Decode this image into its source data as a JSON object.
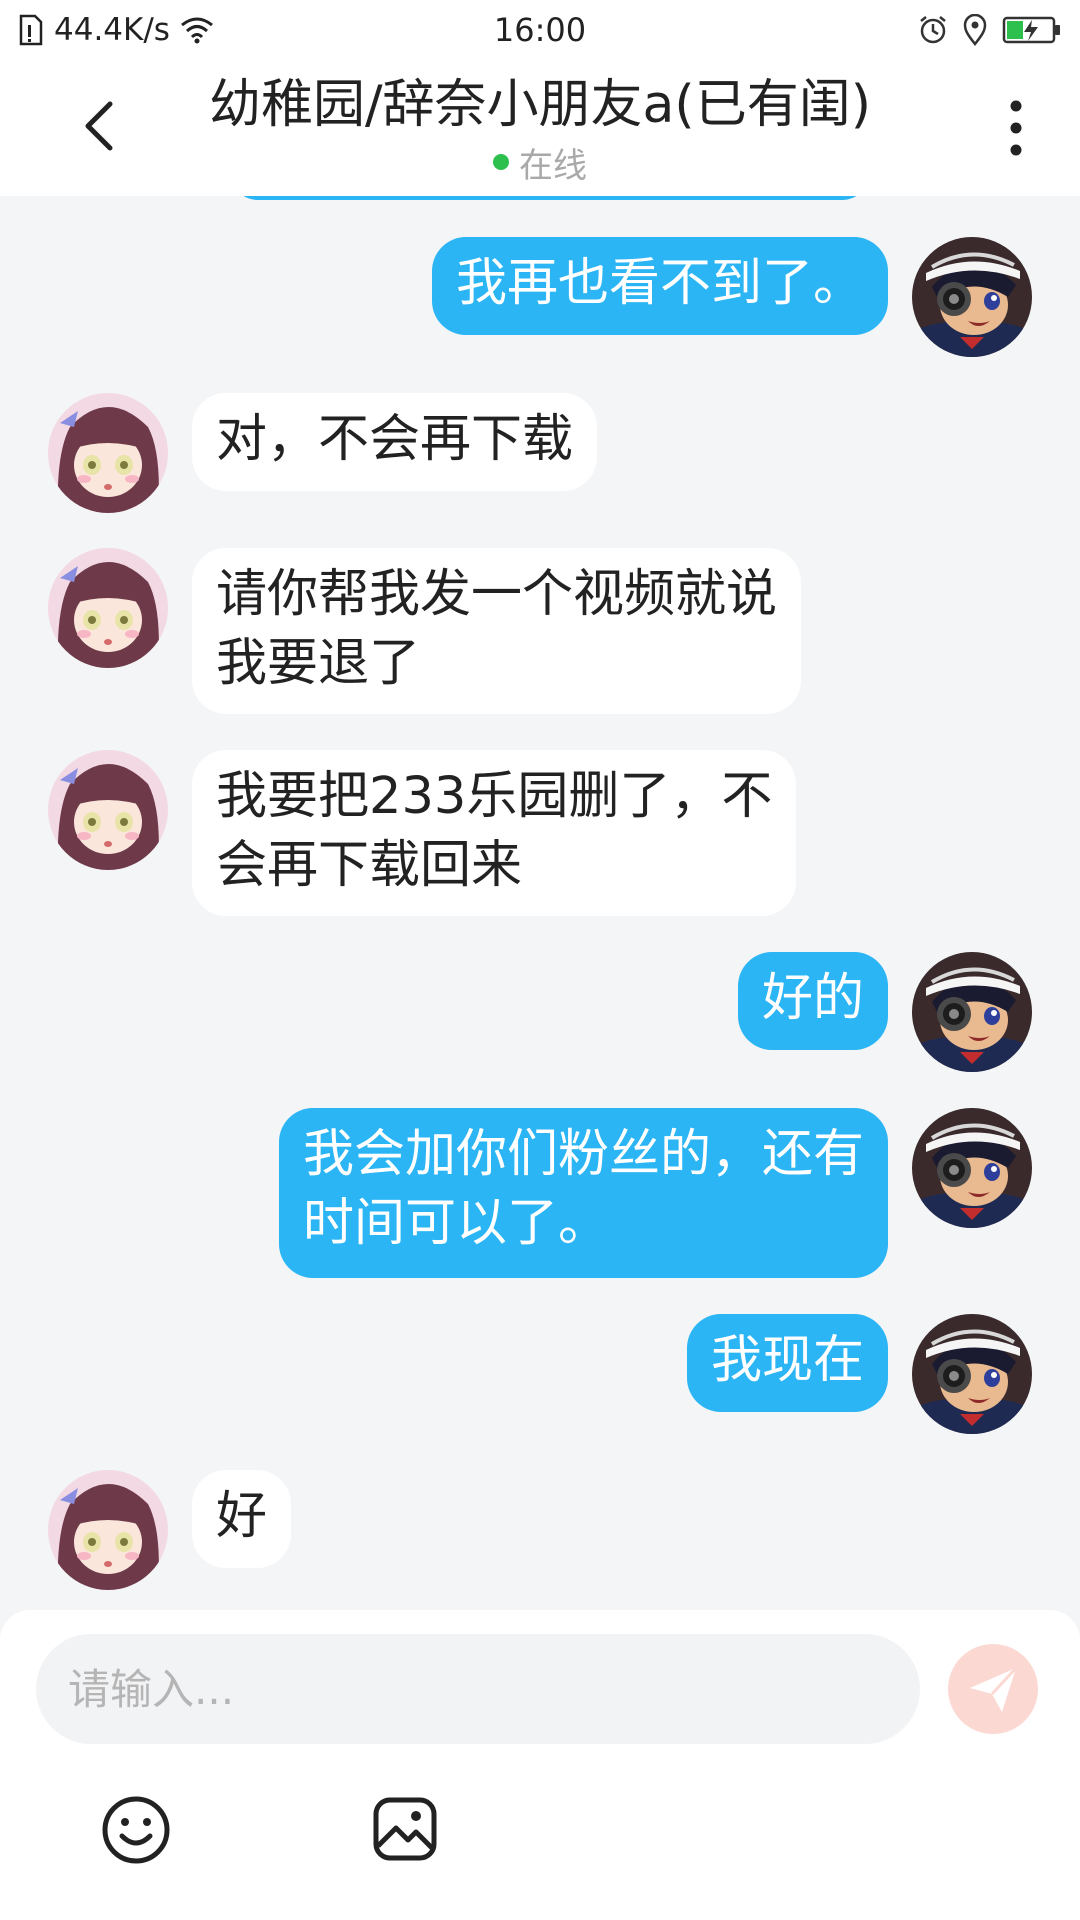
{
  "status_bar": {
    "network_speed": "44.4K/s",
    "time": "16:00"
  },
  "header": {
    "title": "幼稚园/辞奈小朋友a(已有闺)",
    "status": "在线"
  },
  "messages": [
    {
      "side": "out",
      "lines": [
        "我再也看不到了。"
      ]
    },
    {
      "side": "in",
      "lines": [
        "对，不会再下载"
      ]
    },
    {
      "side": "in",
      "lines": [
        "请你帮我发一个视频就说",
        "我要退了"
      ]
    },
    {
      "side": "in",
      "lines": [
        "我要把233乐园删了，不",
        "会再下载回来"
      ]
    },
    {
      "side": "out",
      "lines": [
        "好的"
      ]
    },
    {
      "side": "out",
      "lines": [
        "我会加你们粉丝的，还有",
        "时间可以了。"
      ]
    },
    {
      "side": "out",
      "lines": [
        "我现在"
      ]
    },
    {
      "side": "in",
      "lines": [
        "好"
      ]
    }
  ],
  "input": {
    "placeholder": "请输入..."
  },
  "icons": {
    "back": "chevron-left-icon",
    "more": "more-vertical-icon",
    "send": "send-icon",
    "emoji": "smiley-icon",
    "image": "image-icon"
  },
  "colors": {
    "outgoing_bubble": "#2bb5f5",
    "incoming_bubble": "#ffffff",
    "chat_background": "#f3f5f7",
    "online_dot": "#2ec04f",
    "send_button": "#fbd9d2"
  }
}
